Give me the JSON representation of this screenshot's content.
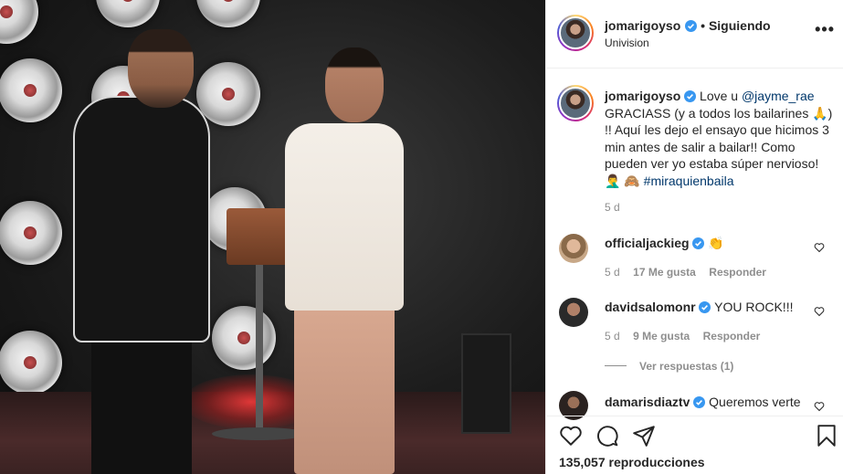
{
  "post": {
    "author": "jomarigoyso",
    "follow_label": "• Siguiendo",
    "location": "Univision",
    "more_label": "•••"
  },
  "caption": {
    "author": "jomarigoyso",
    "text_1": "Love u ",
    "mention": "@jayme_rae",
    "text_2": "GRACIASS (y a todos los bailarines 🙏) !! Aquí les dejo el ensayo que hicimos 3 min antes de salir a bailar!! Como pueden ver yo estaba súper nervioso! 🤦‍♂️ 🙈 ",
    "hashtag": "#miraquienbaila",
    "time": "5 d"
  },
  "comments": [
    {
      "user": "officialjackieg",
      "text": "👏",
      "time": "5 d",
      "likes": "17 Me gusta",
      "reply": "Responder"
    },
    {
      "user": "davidsalomonr",
      "text": "YOU ROCK!!!",
      "time": "5 d",
      "likes": "9 Me gusta",
      "reply": "Responder",
      "replies": "Ver respuestas (1)"
    },
    {
      "user": "damarisdiaztv",
      "text": "Queremos verte"
    }
  ],
  "footer": {
    "views": "135,057 reproducciones"
  },
  "colors": {
    "verified": "#3897f0",
    "link": "#00376b"
  }
}
